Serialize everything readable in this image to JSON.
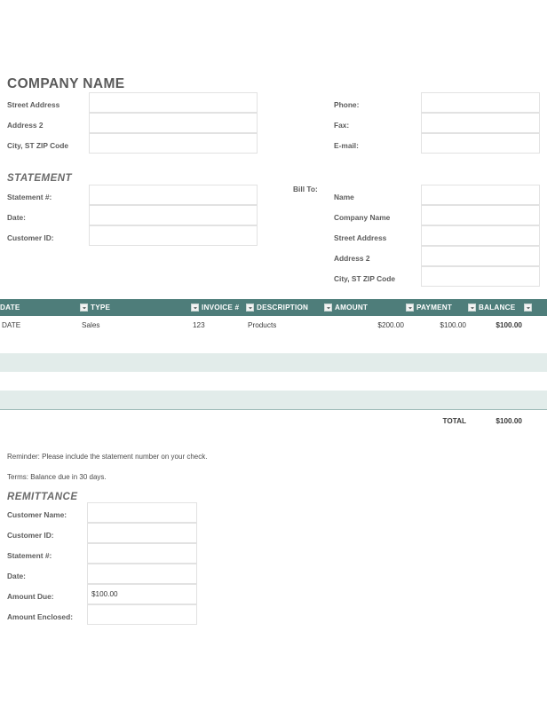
{
  "company": {
    "name": "COMPANY NAME",
    "address_fields": [
      {
        "label": "Street Address",
        "value": ""
      },
      {
        "label": "Address 2",
        "value": ""
      },
      {
        "label": "City, ST  ZIP Code",
        "value": ""
      }
    ],
    "contact_fields": [
      {
        "label": "Phone:",
        "value": ""
      },
      {
        "label": "Fax:",
        "value": ""
      },
      {
        "label": "E-mail:",
        "value": ""
      }
    ]
  },
  "statement": {
    "title": "STATEMENT",
    "fields": [
      {
        "label": "Statement #:",
        "value": ""
      },
      {
        "label": "Date:",
        "value": ""
      },
      {
        "label": "Customer ID:",
        "value": ""
      }
    ]
  },
  "bill_to": {
    "label": "Bill To:",
    "fields": [
      {
        "label": "Name",
        "value": ""
      },
      {
        "label": "Company Name",
        "value": ""
      },
      {
        "label": "Street Address",
        "value": ""
      },
      {
        "label": "Address 2",
        "value": ""
      },
      {
        "label": "City, ST  ZIP Code",
        "value": ""
      }
    ]
  },
  "table": {
    "header_color": "#4e7d7a",
    "stripe_color": "#e2ecea",
    "columns": [
      {
        "label": "DATE",
        "filter": true
      },
      {
        "label": "TYPE",
        "filter": true
      },
      {
        "label": "INVOICE #",
        "filter": true
      },
      {
        "label": "DESCRIPTION",
        "filter": true
      },
      {
        "label": "AMOUNT",
        "filter": true
      },
      {
        "label": "PAYMENT",
        "filter": true
      },
      {
        "label": "BALANCE",
        "filter": true
      },
      {
        "label": "",
        "filter": true
      }
    ],
    "rows": [
      {
        "date": "DATE",
        "type": "Sales",
        "invoice": "123",
        "description": "Products",
        "amount": "$200.00",
        "payment": "$100.00",
        "balance": "$100.00"
      }
    ],
    "empty_row_count": 4,
    "total_label": "TOTAL",
    "total_value": "$100.00"
  },
  "notes": {
    "reminder": "Reminder: Please include the statement number on your check.",
    "terms": "Terms: Balance due in 30 days."
  },
  "remittance": {
    "title": "REMITTANCE",
    "fields": [
      {
        "label": "Customer Name:",
        "value": ""
      },
      {
        "label": "Customer ID:",
        "value": ""
      },
      {
        "label": "Statement #:",
        "value": ""
      },
      {
        "label": "Date:",
        "value": ""
      },
      {
        "label": "Amount Due:",
        "value": "$100.00"
      },
      {
        "label": "Amount Enclosed:",
        "value": ""
      }
    ]
  }
}
